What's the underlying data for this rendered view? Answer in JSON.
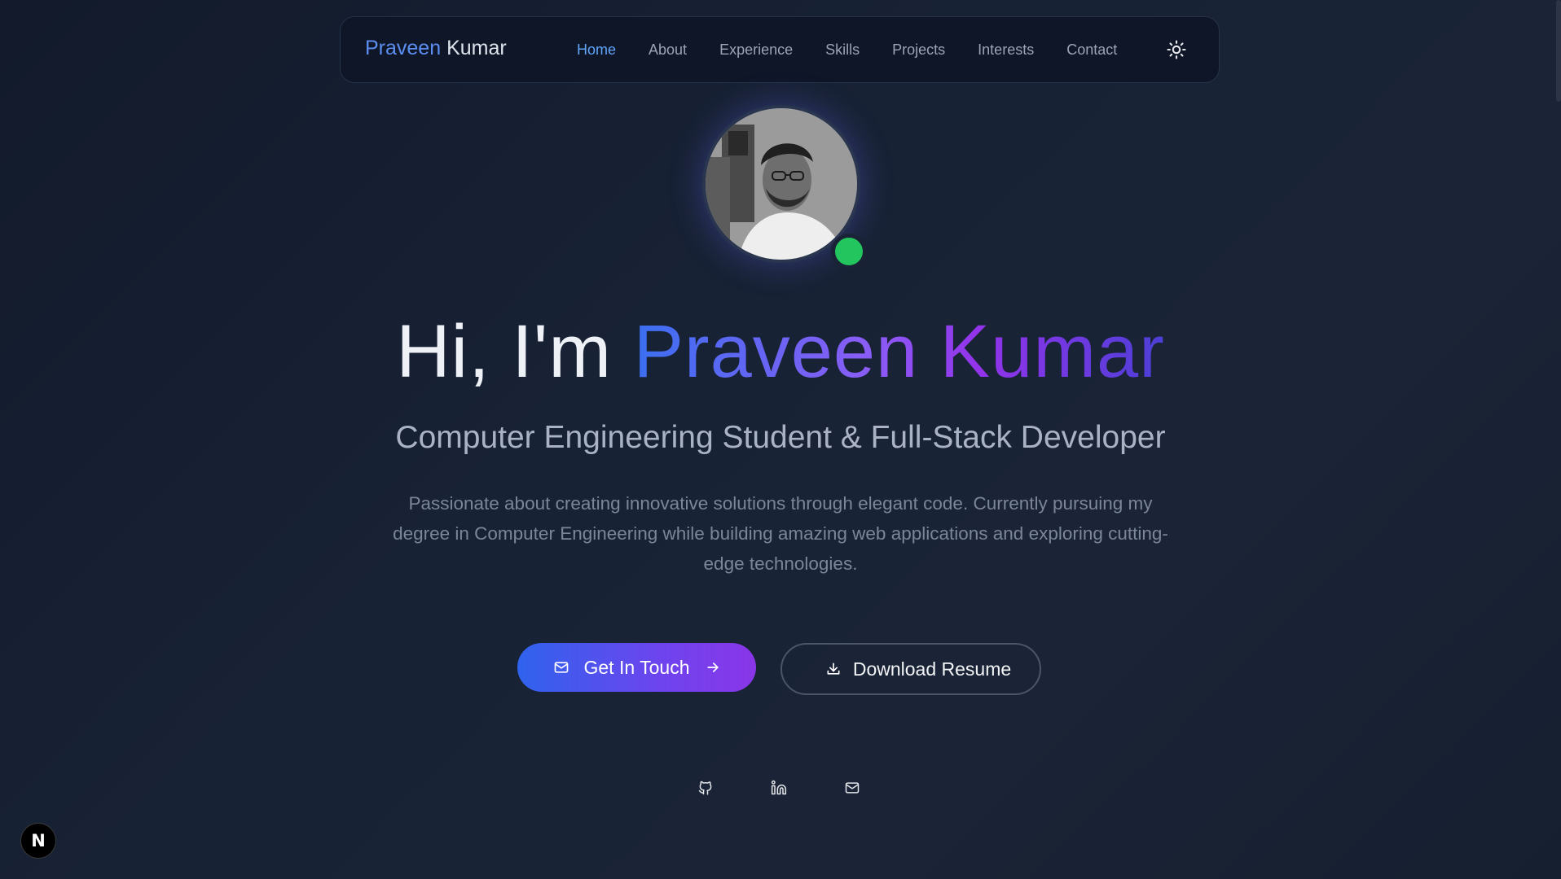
{
  "brand": {
    "first": "Praveen",
    "last": "Kumar"
  },
  "nav": {
    "items": [
      {
        "label": "Home",
        "active": true
      },
      {
        "label": "About"
      },
      {
        "label": "Experience"
      },
      {
        "label": "Skills"
      },
      {
        "label": "Projects"
      },
      {
        "label": "Interests"
      },
      {
        "label": "Contact"
      }
    ],
    "theme_icon": "sun-icon"
  },
  "hero": {
    "greeting": "Hi, I'm",
    "name": "Praveen Kumar",
    "subtitle": "Computer Engineering Student & Full-Stack Developer",
    "description": "Passionate about creating innovative solutions through elegant code. Currently pursuing my degree in Computer Engineering while building amazing web applications and exploring cutting-edge technologies.",
    "status_color": "#22c55e"
  },
  "buttons": {
    "primary_label": "Get In Touch",
    "secondary_label": "Download Resume"
  },
  "socials": [
    {
      "icon": "github-icon"
    },
    {
      "icon": "linkedin-icon"
    },
    {
      "icon": "mail-icon"
    }
  ],
  "badge": {
    "label": "N"
  },
  "colors": {
    "accent_blue": "#3b82f6",
    "accent_purple": "#8b5cf6",
    "background": "#161f30"
  }
}
